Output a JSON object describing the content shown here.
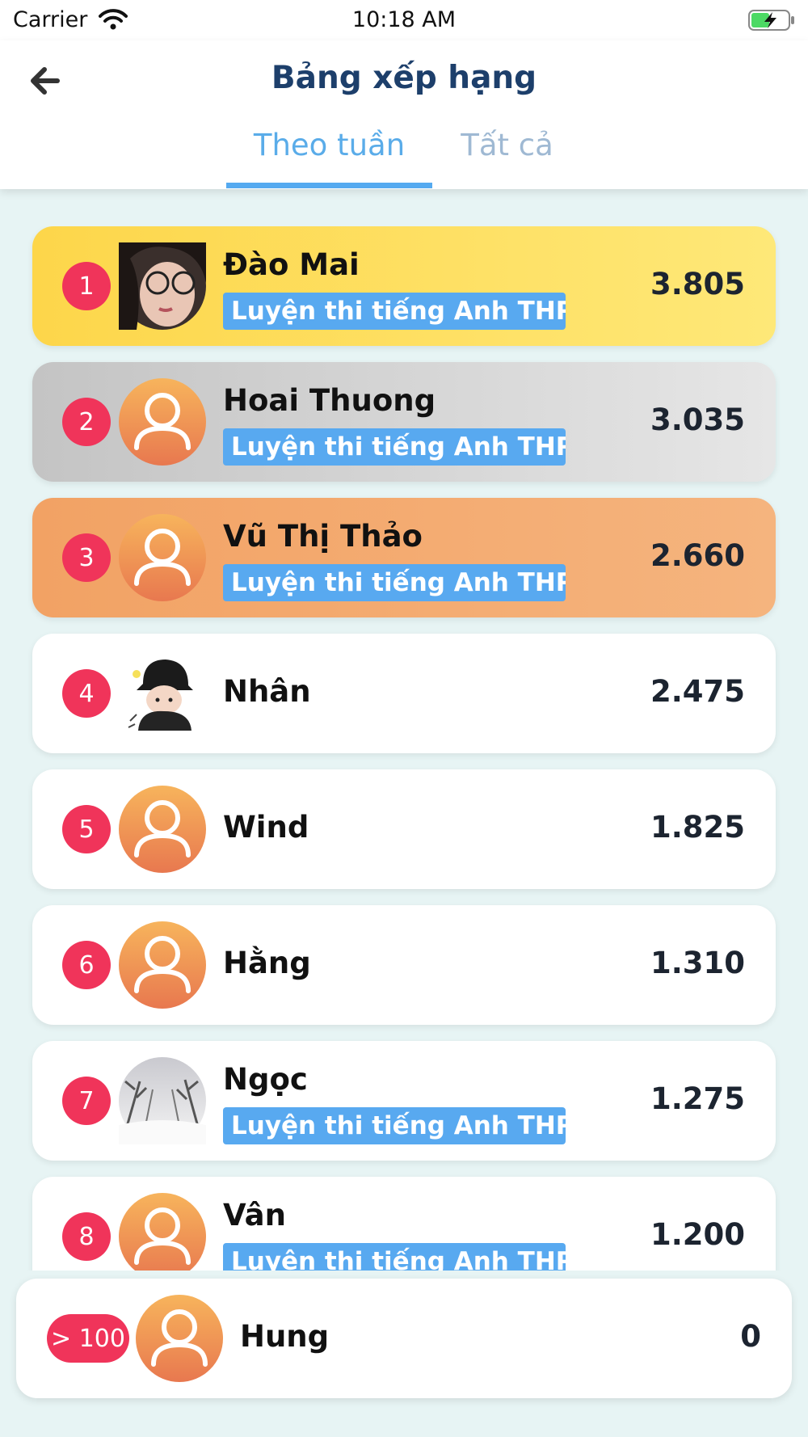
{
  "status_bar": {
    "carrier": "Carrier",
    "time": "10:18 AM",
    "wifi_icon": "wifi-icon",
    "battery_icon": "battery-charging-icon"
  },
  "header": {
    "title": "Bảng xếp hạng",
    "back_icon": "arrow-left-icon",
    "tabs": [
      {
        "label": "Theo tuần",
        "active": true
      },
      {
        "label": "Tất cả",
        "active": false
      }
    ],
    "colors": {
      "title": "#1d3f6b",
      "tab_active": "#5aace9",
      "tab_inactive": "#9fb9d3"
    }
  },
  "leaderboard": [
    {
      "rank": "1",
      "name": "Đào Mai",
      "course": "Luyện thi tiếng Anh THPT",
      "score": "3.805",
      "avatar": "photo-girl-glasses",
      "highlight": "gold"
    },
    {
      "rank": "2",
      "name": "Hoai Thuong",
      "course": "Luyện thi tiếng Anh THPT",
      "score": "3.035",
      "avatar": "default-user-icon",
      "highlight": "silver"
    },
    {
      "rank": "3",
      "name": "Vũ Thị Thảo",
      "course": "Luyện thi tiếng Anh THPT",
      "score": "2.660",
      "avatar": "default-user-icon",
      "highlight": "bronze"
    },
    {
      "rank": "4",
      "name": "Nhân",
      "course": "",
      "score": "2.475",
      "avatar": "cartoon-black-hat",
      "highlight": "none"
    },
    {
      "rank": "5",
      "name": "Wind",
      "course": "",
      "score": "1.825",
      "avatar": "default-user-icon",
      "highlight": "none"
    },
    {
      "rank": "6",
      "name": "Hằng",
      "course": "",
      "score": "1.310",
      "avatar": "default-user-icon",
      "highlight": "none"
    },
    {
      "rank": "7",
      "name": "Ngọc",
      "course": "Luyện thi tiếng Anh THPT",
      "score": "1.275",
      "avatar": "photo-snowy-trees",
      "highlight": "none"
    },
    {
      "rank": "8",
      "name": "Vân",
      "course": "Luyện thi tiếng Anh THPT",
      "score": "1.200",
      "avatar": "default-user-icon",
      "highlight": "none"
    }
  ],
  "current_user": {
    "rank": "> 100",
    "name": "Hung",
    "score": "0",
    "avatar": "default-user-icon"
  },
  "colors": {
    "gold": "#fde36b",
    "silver": "#d2d2d2",
    "bronze": "#f4a870",
    "rank_badge": "#f0345a",
    "course_tag": "#58a9f0",
    "background": "#e7f4f4"
  }
}
